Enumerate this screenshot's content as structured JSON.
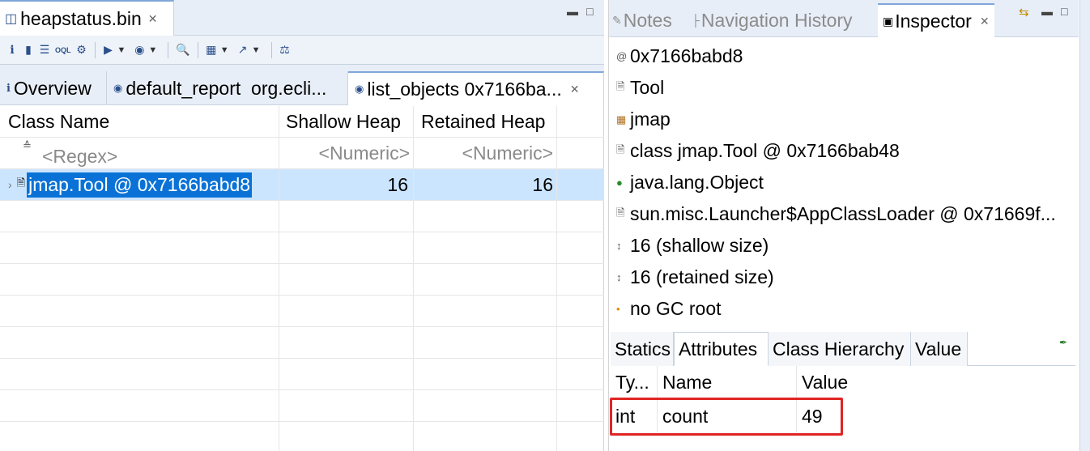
{
  "editor": {
    "file_tab": "heapstatus.bin",
    "tabs": [
      {
        "label": "Overview"
      },
      {
        "label": "default_report  org.ecli..."
      },
      {
        "label": "list_objects 0x7166ba..."
      }
    ]
  },
  "table": {
    "headers": [
      "Class Name",
      "Shallow Heap",
      "Retained Heap"
    ],
    "filters": [
      "<Regex>",
      "<Numeric>",
      "<Numeric>"
    ],
    "rows": [
      {
        "name": "jmap.Tool @ 0x7166babd8",
        "shallow": "16",
        "retained": "16"
      }
    ]
  },
  "inspector": {
    "tabs": [
      "Notes",
      "Navigation History",
      "Inspector"
    ],
    "properties": [
      {
        "icon": "address-icon",
        "text": "0x7166babd8"
      },
      {
        "icon": "class-file-icon",
        "text": "Tool"
      },
      {
        "icon": "package-icon",
        "text": "jmap"
      },
      {
        "icon": "class-object-icon",
        "text": "class jmap.Tool @ 0x7166bab48"
      },
      {
        "icon": "superclass-icon",
        "text": "java.lang.Object"
      },
      {
        "icon": "classloader-icon",
        "text": "sun.misc.Launcher$AppClassLoader @ 0x71669f..."
      },
      {
        "icon": "size-icon",
        "text": "16 (shallow size)"
      },
      {
        "icon": "size-icon",
        "text": "16 (retained size)"
      },
      {
        "icon": "gc-root-icon",
        "text": "no GC root"
      }
    ],
    "attr_tabs": [
      "Statics",
      "Attributes",
      "Class Hierarchy",
      "Value"
    ],
    "attr_headers": [
      "Ty...",
      "Name",
      "Value"
    ],
    "attr_rows": [
      {
        "type": "int",
        "name": "count",
        "value": "49"
      }
    ]
  },
  "colors": {
    "selection": "#0a72d6",
    "selection_row": "#cce5ff",
    "highlight_box": "#e02424",
    "tab_bar": "#e8eef7"
  }
}
